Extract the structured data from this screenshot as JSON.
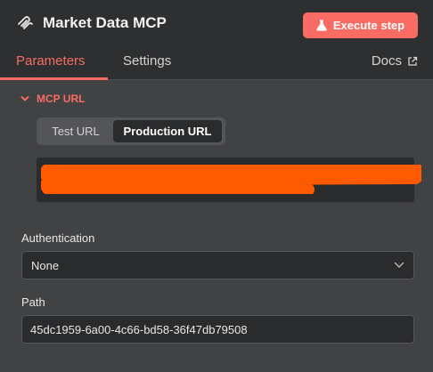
{
  "header": {
    "title": "Market Data MCP",
    "node_icon": "mcp-icon",
    "execute_button": {
      "label": "Execute step",
      "icon": "flask-icon"
    }
  },
  "tabs": [
    {
      "label": "Parameters",
      "active": true
    },
    {
      "label": "Settings",
      "active": false
    }
  ],
  "docs_link": {
    "label": "Docs",
    "icon": "external-link-icon"
  },
  "mcp_url_section": {
    "label": "MCP URL",
    "expanded": true,
    "url_mode_options": [
      "Test URL",
      "Production URL"
    ],
    "selected_mode": "Production URL",
    "url_value_redacted": true
  },
  "fields": {
    "authentication": {
      "label": "Authentication",
      "value": "None"
    },
    "path": {
      "label": "Path",
      "value": "45dc1959-6a00-4c66-bd58-36f47db79508"
    }
  },
  "colors": {
    "accent": "#f86c63",
    "header_bg": "#2e2f31",
    "panel_bg": "#414244",
    "input_bg": "#2a2b2d",
    "redaction": "#ff5a00"
  }
}
